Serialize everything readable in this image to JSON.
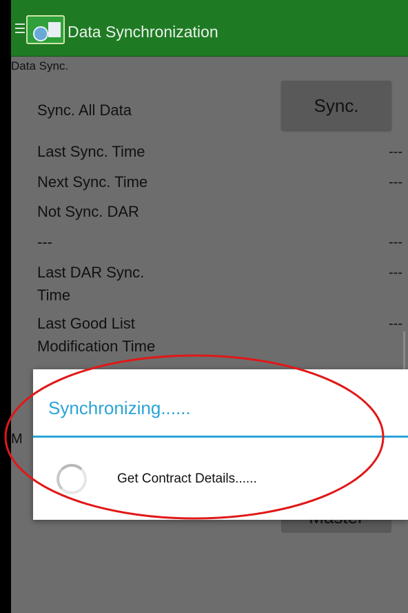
{
  "app_bar": {
    "title": "Data Synchronization",
    "icons": [
      "menu-icon",
      "app-logo-icon"
    ],
    "background": "#1f7a24"
  },
  "content": {
    "section_label": "Data Sync.",
    "sync_all": {
      "label": "Sync. All Data",
      "button_label": "Sync."
    },
    "rows": [
      {
        "label": "Last Sync. Time",
        "value": "---"
      },
      {
        "label": "Next Sync. Time",
        "value": "---"
      },
      {
        "label": "Not Sync. DAR",
        "value": ""
      },
      {
        "label": "---",
        "value": "---"
      },
      {
        "label_lines": [
          "Last DAR Sync.",
          "Time"
        ],
        "value": "---"
      },
      {
        "label_lines": [
          "Last Good List",
          "Modification Time"
        ],
        "value": "---"
      }
    ],
    "partially_hidden": {
      "letter": "M",
      "button_label": "Master"
    }
  },
  "dialog": {
    "title": "Synchronizing......",
    "message": "Get Contract Details......",
    "accent": "#2ba3d8"
  },
  "annotation": {
    "shape": "ellipse",
    "color": "#e01818"
  }
}
